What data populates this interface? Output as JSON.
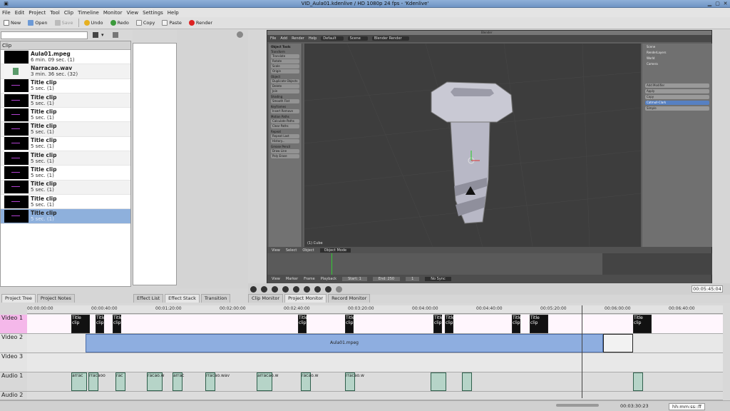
{
  "window": {
    "title": "VID_Aula01.kdenlive / HD 1080p 24 fps - 'Kdenlive'"
  },
  "menu": [
    "File",
    "Edit",
    "Project",
    "Tool",
    "Clip",
    "Timeline",
    "Monitor",
    "View",
    "Settings",
    "Help"
  ],
  "toolbar": {
    "new": "New",
    "open": "Open",
    "save": "Save",
    "undo": "Undo",
    "redo": "Redo",
    "copy": "Copy",
    "paste": "Paste",
    "render": "Render"
  },
  "bin": {
    "header": "Clip",
    "items": [
      {
        "name": "Aula01.mpeg",
        "duration": "6 min. 09 sec. (1)",
        "thumb": "video"
      },
      {
        "name": "Narracao.wav",
        "duration": "3 min. 36 sec. (32)",
        "thumb": "audio"
      },
      {
        "name": "Title clip",
        "duration": "5 sec. (1)",
        "thumb": "title"
      },
      {
        "name": "Title clip",
        "duration": "5 sec. (1)",
        "thumb": "title"
      },
      {
        "name": "Title clip",
        "duration": "5 sec. (1)",
        "thumb": "title"
      },
      {
        "name": "Title clip",
        "duration": "5 sec. (1)",
        "thumb": "title"
      },
      {
        "name": "Title clip",
        "duration": "5 sec. (1)",
        "thumb": "title"
      },
      {
        "name": "Title clip",
        "duration": "5 sec. (1)",
        "thumb": "title"
      },
      {
        "name": "Title clip",
        "duration": "5 sec. (1)",
        "thumb": "title"
      },
      {
        "name": "Title clip",
        "duration": "5 sec. (1)",
        "thumb": "title"
      },
      {
        "name": "Title clip",
        "duration": "5 sec. (1)",
        "thumb": "title"
      },
      {
        "name": "Title clip",
        "duration": "5 sec. (1)",
        "thumb": "title",
        "selected": true
      }
    ]
  },
  "tabs_left": [
    "Project Tree",
    "Project Notes"
  ],
  "tabs_mid": [
    "Effect List",
    "Effect Stack",
    "Transition"
  ],
  "tabs_monitor": [
    "Clip Monitor",
    "Project Monitor",
    "Record Monitor"
  ],
  "monitor": {
    "timecode": "00:05:45:04"
  },
  "blender": {
    "header_left": "Blender",
    "menu": [
      "File",
      "Add",
      "Render",
      "Help"
    ],
    "layout": "Default",
    "scene": "Scene",
    "engine": "Blender Render",
    "tools_title": "Object Tools",
    "tools": [
      {
        "h": "Transform",
        "buttons": [
          "Translate",
          "Rotate",
          "Scale"
        ]
      },
      {
        "h": "",
        "buttons": [
          "Origin"
        ]
      },
      {
        "h": "Object",
        "buttons": [
          "Duplicate Objects",
          "Delete",
          "Join"
        ]
      },
      {
        "h": "Shading",
        "buttons": [
          "Smooth  Flat"
        ]
      },
      {
        "h": "Keyframes",
        "buttons": [
          "Insert  Remove"
        ]
      },
      {
        "h": "Motion Paths",
        "buttons": [
          "Calculate Paths",
          "Clear Paths"
        ]
      },
      {
        "h": "Repeat",
        "buttons": [
          "Repeat Last",
          "History..."
        ]
      },
      {
        "h": "Grease Pencil",
        "buttons": [
          "Draw  Line",
          "Poly  Erase"
        ]
      }
    ],
    "props": [
      "Scene",
      "RenderLayers",
      "World",
      "Camera"
    ],
    "modifier_buttons": [
      "Add Modifier",
      "Apply",
      "Copy",
      "Catmull-Clark",
      "Simple"
    ],
    "view_label": "(1) Cube",
    "bottom_header": [
      "View",
      "Select",
      "Object",
      "Object Mode"
    ],
    "timeline_header": [
      "View",
      "Marker",
      "Frame",
      "Playback",
      "Start: 1",
      "End: 250",
      "1",
      "No Sync"
    ]
  },
  "timeline": {
    "ruler": [
      "00:00:00:00",
      "00:00:40:00",
      "00:01:20:00",
      "00:02:00:00",
      "00:02:40:00",
      "00:03:20:00",
      "00:04:00:00",
      "00:04:40:00",
      "00:05:20:00",
      "00:06:00:00",
      "00:06:40:00"
    ],
    "tracks": [
      "Video 1",
      "Video 2",
      "Video 3",
      "Audio 1",
      "Audio 2"
    ],
    "video2_clip": "Aula01.mpeg",
    "title_clip_label": "Title clip",
    "audio_labels": [
      "arrac",
      "rracaoo",
      "rac",
      "racao.w",
      "arrac",
      "rracao.wav",
      "arracao.w",
      "racao.w",
      "rracao.w"
    ]
  },
  "status": {
    "timecode": "00:03:30:23",
    "format": "hh:mm:ss::ff"
  }
}
